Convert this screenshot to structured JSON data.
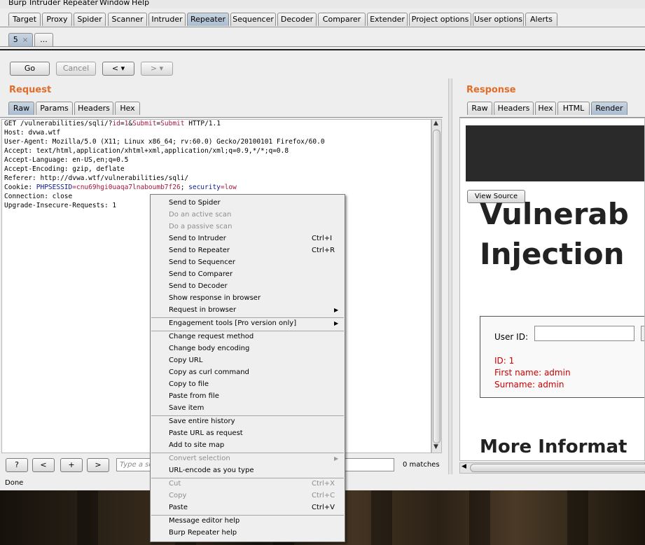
{
  "menubar": [
    "Burp",
    "Intruder",
    "Repeater",
    "Window",
    "Help"
  ],
  "main_tabs": [
    "Target",
    "Proxy",
    "Spider",
    "Scanner",
    "Intruder",
    "Repeater",
    "Sequencer",
    "Decoder",
    "Comparer",
    "Extender",
    "Project options",
    "User options",
    "Alerts"
  ],
  "selected_main_tab": "Repeater",
  "sub_tabs": {
    "active": "5",
    "active_close": "×",
    "more": "..."
  },
  "toolbar": {
    "go": "Go",
    "cancel": "Cancel",
    "back": "< ▾",
    "forward": "> ▾"
  },
  "request": {
    "title": "Request",
    "tabs": [
      "Raw",
      "Params",
      "Headers",
      "Hex"
    ],
    "lines": {
      "l1a": "GET /vulnerabilities/sqli/?",
      "l1b": "id",
      "l1c": "=",
      "l1d": "1",
      "l1e": "&",
      "l1f": "Submit",
      "l1g": "=",
      "l1h": "Submit",
      "l1i": " HTTP/1.1",
      "l2": "Host: dvwa.wtf",
      "l3": "User-Agent: Mozilla/5.0 (X11; Linux x86_64; rv:60.0) Gecko/20100101 Firefox/60.0",
      "l4": "Accept: text/html,application/xhtml+xml,application/xml;q=0.9,*/*;q=0.8",
      "l5": "Accept-Language: en-US,en;q=0.5",
      "l6": "Accept-Encoding: gzip, deflate",
      "l7": "Referer: http://dvwa.wtf/vulnerabilities/sqli/",
      "l8a": "Cookie: ",
      "l8b": "PHPSESSID",
      "l8c": "=cnu69hgi0uaqa7lnaboumb7f26",
      "l8d": "; ",
      "l8e": "security",
      "l8f": "=low",
      "l9": "Connection: close",
      "l10": "Upgrade-Insecure-Requests: 1"
    },
    "search": {
      "help": "?",
      "prev": "<",
      "add": "+",
      "next": ">",
      "placeholder": "Type a search term",
      "visible_placeholder": "Type a se",
      "matches": "0 matches"
    }
  },
  "status": "Done",
  "response": {
    "title": "Response",
    "tabs": [
      "Raw",
      "Headers",
      "Hex",
      "HTML",
      "Render"
    ],
    "selected_tab": "Render",
    "render": {
      "view_source": "View Source",
      "heading_line1": "Vulnerab",
      "heading_line2": "Injection",
      "user_id_label": "User ID:",
      "result_id": "ID: 1",
      "result_first": "First name: admin",
      "result_surname": "Surname: admin",
      "more_info": "More Informat"
    }
  },
  "context_menu": {
    "send_spider": "Send to Spider",
    "active_scan": "Do an active scan",
    "passive_scan": "Do a passive scan",
    "send_intruder": "Send to Intruder",
    "send_intruder_sc": "Ctrl+I",
    "send_repeater": "Send to Repeater",
    "send_repeater_sc": "Ctrl+R",
    "send_sequencer": "Send to Sequencer",
    "send_comparer": "Send to Comparer",
    "send_decoder": "Send to Decoder",
    "show_response": "Show response in browser",
    "request_browser": "Request in browser",
    "engagement": "Engagement tools [Pro version only]",
    "change_method": "Change request method",
    "change_encoding": "Change body encoding",
    "copy_url": "Copy URL",
    "copy_curl": "Copy as curl command",
    "copy_file": "Copy to file",
    "paste_file": "Paste from file",
    "save_item": "Save item",
    "save_history": "Save entire history",
    "paste_url": "Paste URL as request",
    "add_sitemap": "Add to site map",
    "convert_sel": "Convert selection",
    "url_encode": "URL-encode as you type",
    "cut": "Cut",
    "cut_sc": "Ctrl+X",
    "copy": "Copy",
    "copy_sc": "Ctrl+C",
    "paste": "Paste",
    "paste_sc": "Ctrl+V",
    "editor_help": "Message editor help",
    "repeater_help": "Burp Repeater help",
    "submenu_arrow": "▶"
  }
}
